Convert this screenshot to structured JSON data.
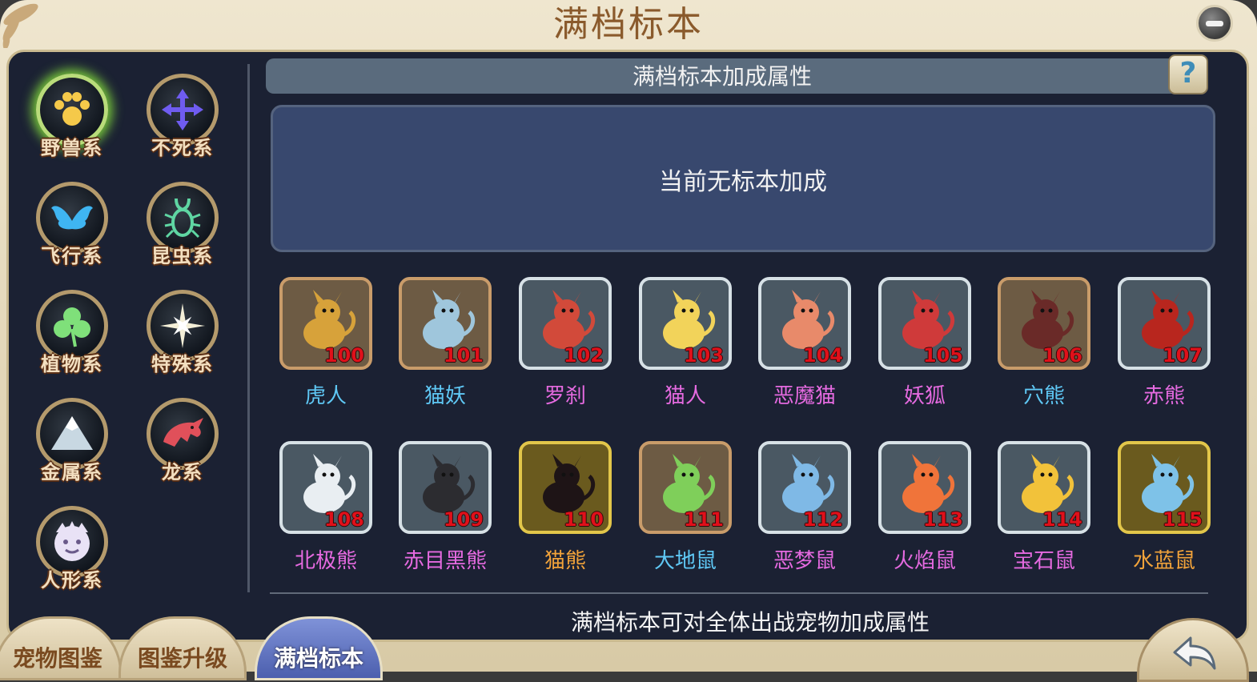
{
  "window": {
    "title": "满档标本"
  },
  "categories": [
    {
      "label": "野兽系",
      "icon": "paw-icon",
      "color": "#f5c94a",
      "active": true
    },
    {
      "label": "不死系",
      "icon": "cross-arrows-icon",
      "color": "#6f5cf0",
      "active": false
    },
    {
      "label": "飞行系",
      "icon": "wings-icon",
      "color": "#3fb5f2",
      "active": false
    },
    {
      "label": "昆虫系",
      "icon": "beetle-icon",
      "color": "#5fd6a3",
      "active": false
    },
    {
      "label": "植物系",
      "icon": "clover-icon",
      "color": "#7fe07a",
      "active": false
    },
    {
      "label": "特殊系",
      "icon": "star-burst-icon",
      "color": "#f4efd8",
      "active": false
    },
    {
      "label": "金属系",
      "icon": "mountain-icon",
      "color": "#c8d8e2",
      "active": false
    },
    {
      "label": "龙系",
      "icon": "dragon-icon",
      "color": "#e0505a",
      "active": false
    },
    {
      "label": "人形系",
      "icon": "face-icon",
      "color": "#e9e2f6",
      "active": false
    }
  ],
  "bonus_header": "满档标本加成属性",
  "bonus_text": "当前无标本加成",
  "specimens": [
    {
      "num": "100",
      "name": "虎人",
      "frame": "bronze",
      "name_color": "#5fc8f5",
      "creature": "#d7a23a"
    },
    {
      "num": "101",
      "name": "猫妖",
      "frame": "bronze",
      "name_color": "#5fc8f5",
      "creature": "#9fc6dc"
    },
    {
      "num": "102",
      "name": "罗刹",
      "frame": "silver",
      "name_color": "#e56ae0",
      "creature": "#d24a3a"
    },
    {
      "num": "103",
      "name": "猫人",
      "frame": "silver",
      "name_color": "#e56ae0",
      "creature": "#f2d35a"
    },
    {
      "num": "104",
      "name": "恶魔猫",
      "frame": "silver",
      "name_color": "#e56ae0",
      "creature": "#e88a6a"
    },
    {
      "num": "105",
      "name": "妖狐",
      "frame": "silver",
      "name_color": "#e56ae0",
      "creature": "#cf3a3a"
    },
    {
      "num": "106",
      "name": "穴熊",
      "frame": "bronze",
      "name_color": "#5fc8f5",
      "creature": "#6a2a28"
    },
    {
      "num": "107",
      "name": "赤熊",
      "frame": "silver",
      "name_color": "#e56ae0",
      "creature": "#b8261e"
    },
    {
      "num": "108",
      "name": "北极熊",
      "frame": "silver",
      "name_color": "#e56ae0",
      "creature": "#e9eef2"
    },
    {
      "num": "109",
      "name": "赤目黑熊",
      "frame": "silver",
      "name_color": "#e56ae0",
      "creature": "#2c2c30"
    },
    {
      "num": "110",
      "name": "猫熊",
      "frame": "gold",
      "name_color": "#f2a33a",
      "creature": "#1e1416"
    },
    {
      "num": "111",
      "name": "大地鼠",
      "frame": "bronze",
      "name_color": "#5fc8f5",
      "creature": "#7fcf5a"
    },
    {
      "num": "112",
      "name": "恶梦鼠",
      "frame": "silver",
      "name_color": "#e56ae0",
      "creature": "#7fb9e6"
    },
    {
      "num": "113",
      "name": "火焰鼠",
      "frame": "silver",
      "name_color": "#e56ae0",
      "creature": "#f0743a"
    },
    {
      "num": "114",
      "name": "宝石鼠",
      "frame": "silver",
      "name_color": "#e56ae0",
      "creature": "#f2c23a"
    },
    {
      "num": "115",
      "name": "水蓝鼠",
      "frame": "gold",
      "name_color": "#f2a33a",
      "creature": "#7ec2e8"
    }
  ],
  "footer_text": "满档标本可对全体出战宠物加成属性",
  "tabs": [
    {
      "label": "宠物图鉴",
      "active": false
    },
    {
      "label": "图鉴升级",
      "active": false
    },
    {
      "label": "满档标本",
      "active": true
    }
  ],
  "help_label": "?"
}
